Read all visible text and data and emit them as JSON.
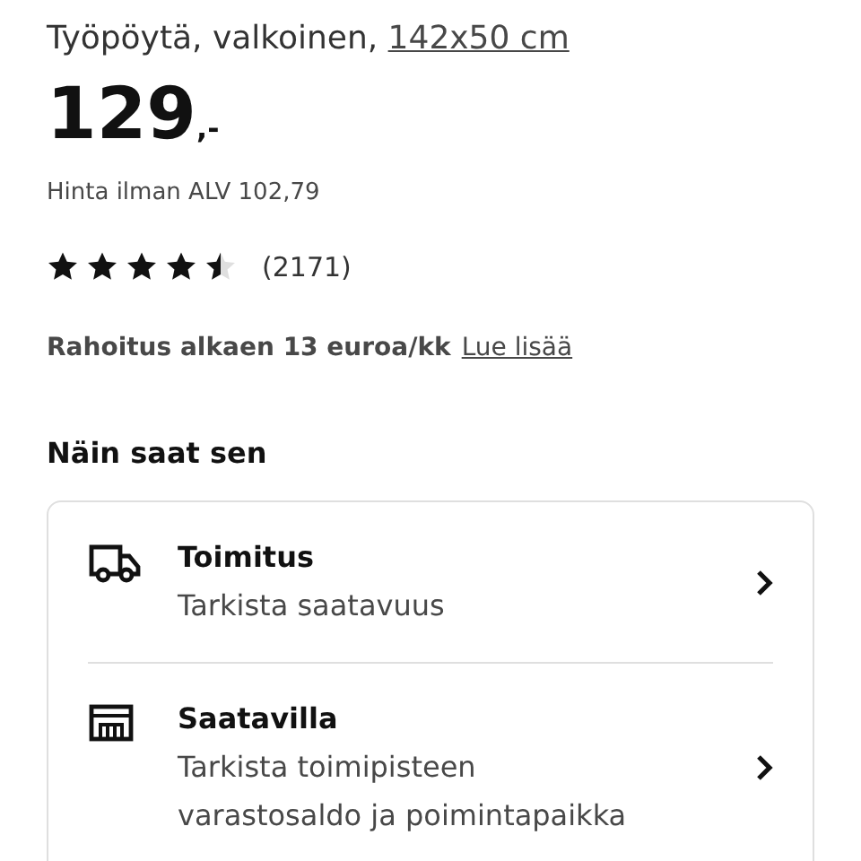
{
  "product": {
    "description": "Työpöytä, valkoinen, ",
    "size_link": "142x50 cm"
  },
  "price": {
    "main": "129",
    "suffix": ",-"
  },
  "price_without_vat": "Hinta ilman ALV 102,79",
  "rating": {
    "stars": 4.5,
    "count": "(2171)"
  },
  "financing": {
    "text": "Rahoitus alkaen 13 euroa/kk",
    "link": "Lue lisää"
  },
  "section_title": "Näin saat sen",
  "options": [
    {
      "kind": "delivery",
      "title": "Toimitus",
      "subtitle": "Tarkista saatavuus"
    },
    {
      "kind": "store",
      "title": "Saatavilla",
      "subtitle": "Tarkista toimipisteen varastosaldo ja poimintapaikka"
    }
  ]
}
